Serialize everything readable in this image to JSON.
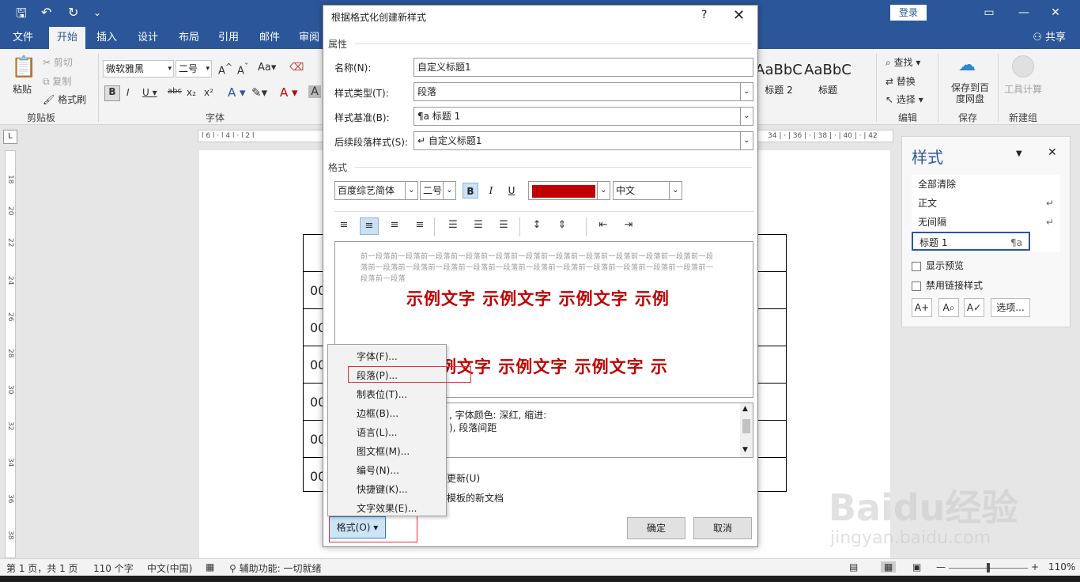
{
  "app": {
    "login_label": "登录",
    "share_label": "共享",
    "tabs": [
      "文件",
      "开始",
      "插入",
      "设计",
      "布局",
      "引用",
      "邮件",
      "审阅"
    ]
  },
  "ribbon": {
    "paste": "粘贴",
    "cut": "剪切",
    "copy": "复制",
    "format_painter": "格式刷",
    "clipboard_label": "剪贴板",
    "font_name": "微软雅黑",
    "font_size": "二号",
    "font_group_label": "字体",
    "style_samples": [
      "AaBbC",
      "AaBbC"
    ],
    "style_sample_names": [
      "标题 2",
      "标题"
    ],
    "find": "查找",
    "replace": "替换",
    "select": "选择",
    "edit_label": "编辑",
    "save_to_baidu": "保存到百度网盘",
    "save_label": "保存",
    "tools_calc": "工具计算",
    "new_group_label": "新建组"
  },
  "document": {
    "row_prefix": [
      "00",
      "00",
      "00",
      "00",
      "00",
      "00"
    ]
  },
  "styles_pane": {
    "title": "样式",
    "items": [
      {
        "name": "全部清除",
        "mark": ""
      },
      {
        "name": "正文",
        "mark": "↵"
      },
      {
        "name": "无间隔",
        "mark": "↵"
      },
      {
        "name": "标题 1",
        "mark": "¶a"
      }
    ],
    "show_preview": "显示预览",
    "disable_linked": "禁用链接样式",
    "options_button": "选项..."
  },
  "status_bar": {
    "page": "第 1 页，共 1 页",
    "words": "110 个字",
    "language": "中文(中国)",
    "accessibility": "辅助功能: 一切就绪",
    "zoom": "110%"
  },
  "dialog": {
    "title": "根据格式化创建新样式",
    "help": "?",
    "section_props": "属性",
    "section_format": "格式",
    "name_label": "名称(N):",
    "name_value": "自定义标题1",
    "type_label": "样式类型(T):",
    "type_value": "段落",
    "based_label": "样式基准(B):",
    "based_value": "¶a 标题 1",
    "next_label": "后续段落样式(S):",
    "next_value": "↵ 自定义标题1",
    "font_name": "百度综艺简体",
    "font_size": "二号",
    "bold": "B",
    "italic": "I",
    "underline": "U",
    "font_color": "#c00000",
    "script": "中文",
    "preview_before": "前一段落前一段落前一段落前一段落前一段落前一段落前一段落前一段落前一段落前一段落前一段落前一段落前一段落前一段落前一段落前一段落前一段落前一段落前一段落前一段落前一段落前一段落前一段落前一段落前一段落",
    "preview_sample_1": "示例文字 示例文字 示例文字 示例",
    "preview_sample_2": "示例文字 示例文字 示例文字 示",
    "desc_line1": ", 字体颜色: 深红, 缩进:",
    "desc_line2": "), 段落间距",
    "auto_update": "动更新(U)",
    "template_docs": "该模板的新文档",
    "format_button": "格式(O) ▾",
    "ok": "确定",
    "cancel": "取消"
  },
  "format_menu": {
    "items": [
      "字体(F)...",
      "段落(P)...",
      "制表位(T)...",
      "边框(B)...",
      "语言(L)...",
      "图文框(M)...",
      "编号(N)...",
      "快捷键(K)...",
      "文字效果(E)..."
    ]
  },
  "watermark": {
    "brand": "Baidu经验",
    "url": "jingyan.baidu.com"
  }
}
